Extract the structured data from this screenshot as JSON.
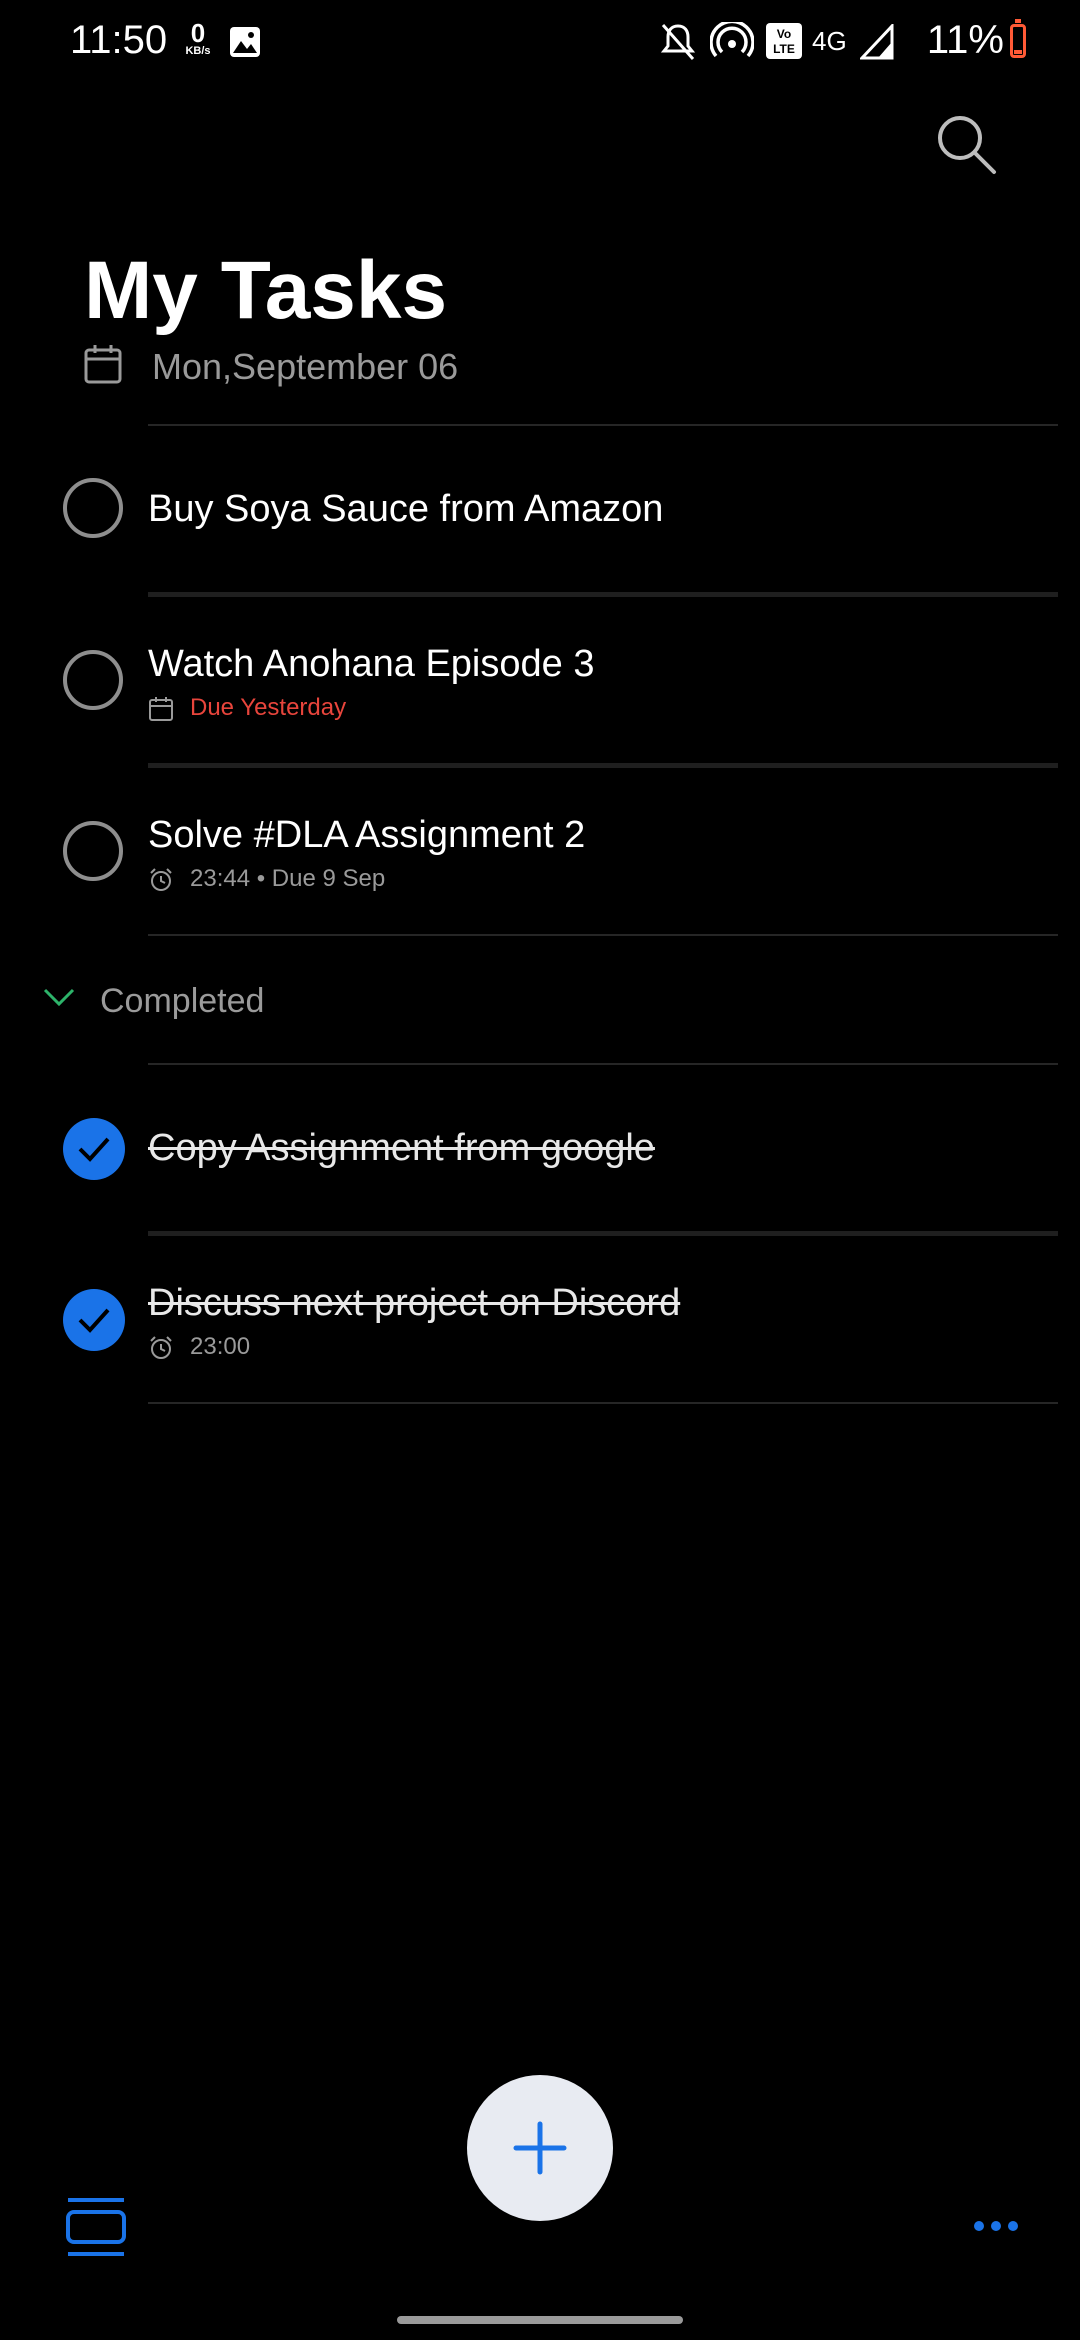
{
  "status_bar": {
    "time": "11:50",
    "net_speed_value": "0",
    "net_speed_unit": "KB/s",
    "network": "4G",
    "battery": "11%",
    "battery_color": "#ff5a36"
  },
  "header": {
    "title": "My Tasks",
    "date": "Mon,September 06"
  },
  "tasks": [
    {
      "title": "Buy Soya Sauce from Amazon",
      "subtitle": "",
      "completed": false
    },
    {
      "title": "Watch Anohana Episode 3",
      "subtitle": "Due Yesterday",
      "subtitle_icon": "calendar-icon",
      "subtitle_color": "#e8453c",
      "completed": false
    },
    {
      "title": "Solve #DLA Assignment 2",
      "subtitle": "23:44 • Due 9 Sep",
      "subtitle_icon": "alarm-icon",
      "completed": false
    }
  ],
  "completed_section": {
    "label": "Completed",
    "items": [
      {
        "title": "Copy Assignment from google",
        "subtitle": "",
        "completed": true
      },
      {
        "title": "Discuss next project on Discord",
        "subtitle": "23:00",
        "subtitle_icon": "alarm-icon",
        "completed": true
      }
    ]
  },
  "colors": {
    "accent": "#1a73e8",
    "background": "#000000",
    "overdue": "#e8453c",
    "fab_bg": "#e8ebf2"
  },
  "icons": {
    "search": "search-icon",
    "add": "plus-icon",
    "lists": "lists-icon",
    "more": "more-horizontal-icon"
  }
}
